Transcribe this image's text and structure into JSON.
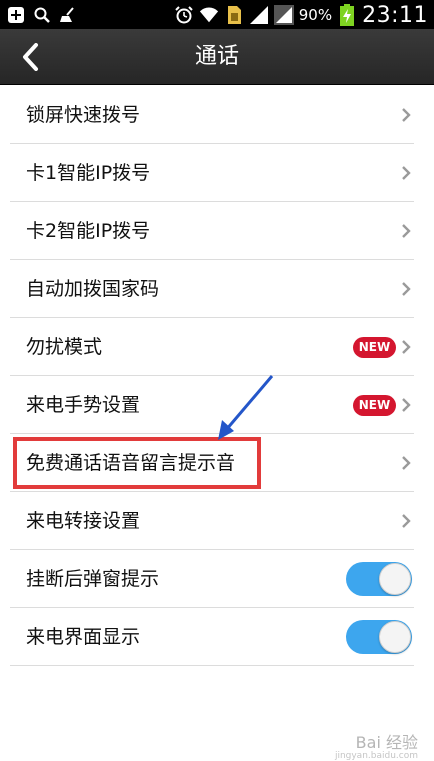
{
  "status_bar": {
    "battery_percent": "90%",
    "time": "23:11",
    "icons": [
      "add-icon",
      "search-icon",
      "broom-icon",
      "alarm-icon",
      "wifi-icon",
      "sim-card-icon",
      "signal-icon",
      "signal-icon",
      "battery-charging-icon"
    ]
  },
  "header": {
    "title": "通话"
  },
  "settings": {
    "items": [
      {
        "label": "锁屏快速拨号",
        "control": "chevron"
      },
      {
        "label": "卡1智能IP拨号",
        "control": "chevron"
      },
      {
        "label": "卡2智能IP拨号",
        "control": "chevron"
      },
      {
        "label": "自动加拨国家码",
        "control": "chevron"
      },
      {
        "label": "勿扰模式",
        "control": "chevron",
        "badge": "NEW"
      },
      {
        "label": "来电手势设置",
        "control": "chevron",
        "badge": "NEW"
      },
      {
        "label": "免费通话语音留言提示音",
        "control": "chevron",
        "highlighted": true
      },
      {
        "label": "来电转接设置",
        "control": "chevron"
      },
      {
        "label": "挂断后弹窗提示",
        "control": "toggle",
        "on": true
      },
      {
        "label": "来电界面显示",
        "control": "toggle",
        "on": true
      }
    ]
  },
  "colors": {
    "badge": "#d4162f",
    "toggle_on": "#3da6ee",
    "highlight_box": "#e23b3b",
    "annotation_arrow": "#2456c9"
  },
  "watermark": {
    "text": "Bai 经验",
    "sub": "jingyan.baidu.com"
  }
}
